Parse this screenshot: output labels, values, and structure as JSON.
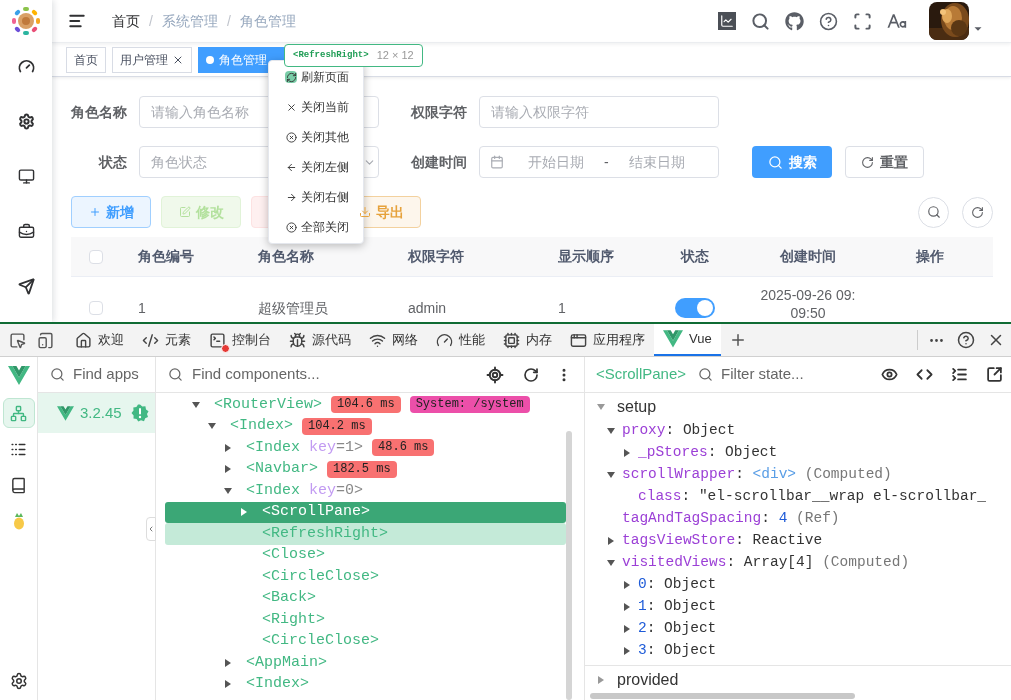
{
  "breadcrumb": [
    {
      "label": "首页",
      "link": true
    },
    {
      "separator": "/",
      "label": "系统管理",
      "link": false
    },
    {
      "separator": "/",
      "label": "角色管理",
      "link": false
    }
  ],
  "tags": [
    {
      "label": "首页",
      "selected": false,
      "closable": false
    },
    {
      "label": "用户管理",
      "selected": false,
      "closable": true
    },
    {
      "label": "角色管理",
      "selected": true,
      "closable": false
    }
  ],
  "inspector_tooltip": {
    "component": "<RefreshRight>",
    "size": "12 × 12"
  },
  "context_menu": [
    {
      "label": "刷新页面",
      "kind": "refresh",
      "inspected": true
    },
    {
      "label": "关闭当前",
      "kind": "close",
      "inspected": false
    },
    {
      "label": "关闭其他",
      "kind": "circle-close",
      "inspected": false
    },
    {
      "label": "关闭左侧",
      "kind": "left",
      "inspected": false
    },
    {
      "label": "关闭右侧",
      "kind": "right",
      "inspected": false
    },
    {
      "label": "全部关闭",
      "kind": "circle-close",
      "inspected": false
    }
  ],
  "form": {
    "rows": [
      [
        {
          "label": "角色名称",
          "kind": "input",
          "placeholder": "请输入角色名称"
        },
        {
          "label": "权限字符",
          "kind": "input",
          "placeholder": "请输入权限字符"
        }
      ],
      [
        {
          "label": "状态",
          "kind": "select",
          "placeholder": "角色状态"
        },
        {
          "label": "创建时间",
          "kind": "daterange",
          "start_placeholder": "开始日期",
          "separator": "-",
          "end_placeholder": "结束日期"
        }
      ]
    ],
    "search": "搜索",
    "reset": "重置"
  },
  "toolbar": [
    {
      "label": "新增",
      "kind": "primary",
      "disabled": false
    },
    {
      "label": "修改",
      "kind": "success",
      "disabled": true
    },
    {
      "kind": "danger",
      "disabled": true
    },
    {
      "label": "导出",
      "kind": "warning",
      "disabled": false
    }
  ],
  "table": {
    "header_checked": false,
    "columns": [
      "角色编号",
      "角色名称",
      "权限字符",
      "显示顺序",
      "状态",
      "创建时间",
      "操作"
    ],
    "rows": [
      {
        "checked": false,
        "cells": [
          "1",
          "超级管理员",
          "admin",
          "1"
        ],
        "status_on": true,
        "created": "2025-09-26 09:09:50"
      }
    ]
  },
  "devtools": {
    "tabs": [
      {
        "label": "欢迎",
        "kind": "home",
        "selected": false,
        "error": false
      },
      {
        "label": "元素",
        "kind": "code",
        "selected": false,
        "error": false
      },
      {
        "label": "控制台",
        "kind": "terminal",
        "selected": false,
        "error": true
      },
      {
        "label": "源代码",
        "kind": "bug",
        "selected": false,
        "error": false
      },
      {
        "label": "网络",
        "kind": "wifi",
        "selected": false,
        "error": false
      },
      {
        "label": "性能",
        "kind": "gauge",
        "selected": false,
        "error": false
      },
      {
        "label": "内存",
        "kind": "cpu",
        "selected": false,
        "error": false
      },
      {
        "label": "应用程序",
        "kind": "app",
        "selected": false,
        "error": false
      },
      {
        "label": "Vue",
        "kind": "vue",
        "selected": true,
        "error": false
      }
    ],
    "vue": {
      "rail": [
        {
          "kind": "components",
          "selected": true
        },
        {
          "kind": "timeline",
          "selected": false
        },
        {
          "kind": "book",
          "selected": false
        },
        {
          "kind": "pinia",
          "selected": false
        }
      ],
      "apps_placeholder": "Find apps",
      "apps": [
        {
          "version": "3.2.45",
          "selected": true,
          "warning": true
        }
      ],
      "components_placeholder": "Find components...",
      "tree": [
        {
          "tag": "<RouterView>",
          "expanded": true,
          "time": "104.6 ms",
          "route": "System: /system",
          "selected": false,
          "hovered": false,
          "children": [
            {
              "tag": "<Index>",
              "expanded": true,
              "time": "104.2 ms",
              "selected": false,
              "hovered": false,
              "children": [
                {
                  "tag": "<Index",
                  "attr": "key",
                  "attr_value": "=1>",
                  "expanded": false,
                  "time": "48.6 ms",
                  "selected": false,
                  "hovered": false
                },
                {
                  "tag": "<Navbar>",
                  "expanded": false,
                  "time": "182.5 ms",
                  "selected": false,
                  "hovered": false
                },
                {
                  "tag": "<Index",
                  "attr": "key",
                  "attr_value": "=0>",
                  "expanded": true,
                  "selected": false,
                  "hovered": false,
                  "children": [
                    {
                      "tag": "<ScrollPane>",
                      "expanded": false,
                      "selected": true,
                      "hovered": false
                    },
                    {
                      "tag": "<RefreshRight>",
                      "selected": false,
                      "hovered": true
                    },
                    {
                      "tag": "<Close>",
                      "selected": false,
                      "hovered": false
                    },
                    {
                      "tag": "<CircleClose>",
                      "selected": false,
                      "hovered": false
                    },
                    {
                      "tag": "<Back>",
                      "selected": false,
                      "hovered": false
                    },
                    {
                      "tag": "<Right>",
                      "selected": false,
                      "hovered": false
                    },
                    {
                      "tag": "<CircleClose>",
                      "selected": false,
                      "hovered": false
                    }
                  ]
                },
                {
                  "tag": "<AppMain>",
                  "expanded": false,
                  "selected": false,
                  "hovered": false
                },
                {
                  "tag": "<Index>",
                  "expanded": false,
                  "selected": false,
                  "hovered": false
                }
              ]
            }
          ]
        }
      ],
      "state": {
        "component": "<ScrollPane>",
        "filter_placeholder": "Filter state...",
        "separator": ":",
        "sections": [
          {
            "title": "setup",
            "expanded": true,
            "items": [
              {
                "key": "proxy",
                "kind": "plain",
                "value": "Object",
                "expanded": true,
                "children": [
                  {
                    "key": "_pStores",
                    "kind": "plain",
                    "value": "Object",
                    "expanded": false
                  }
                ]
              },
              {
                "key": "scrollWrapper",
                "kind": "element",
                "value": "<div>",
                "note": "(Computed)",
                "expanded": true,
                "children": [
                  {
                    "key": "class",
                    "kind": "plain",
                    "value": "\"el-scrollbar__wrap el-scrollbar_"
                  }
                ]
              },
              {
                "key": "tagAndTagSpacing",
                "kind": "number",
                "value": "4",
                "note": "(Ref)"
              },
              {
                "key": "tagsViewStore",
                "kind": "plain",
                "value": "Reactive",
                "expanded": false
              },
              {
                "key": "visitedViews",
                "kind": "plain",
                "value": "Array[4]",
                "note": "(Computed)",
                "expanded": true,
                "children": [
                  {
                    "key": "0",
                    "kind": "index",
                    "value": "Object",
                    "expanded": false
                  },
                  {
                    "key": "1",
                    "kind": "index",
                    "value": "Object",
                    "expanded": false
                  },
                  {
                    "key": "2",
                    "kind": "index",
                    "value": "Object",
                    "expanded": false
                  },
                  {
                    "key": "3",
                    "kind": "index",
                    "value": "Object",
                    "expanded": false
                  }
                ]
              }
            ]
          },
          {
            "title": "provided",
            "expanded": false
          }
        ]
      }
    }
  }
}
